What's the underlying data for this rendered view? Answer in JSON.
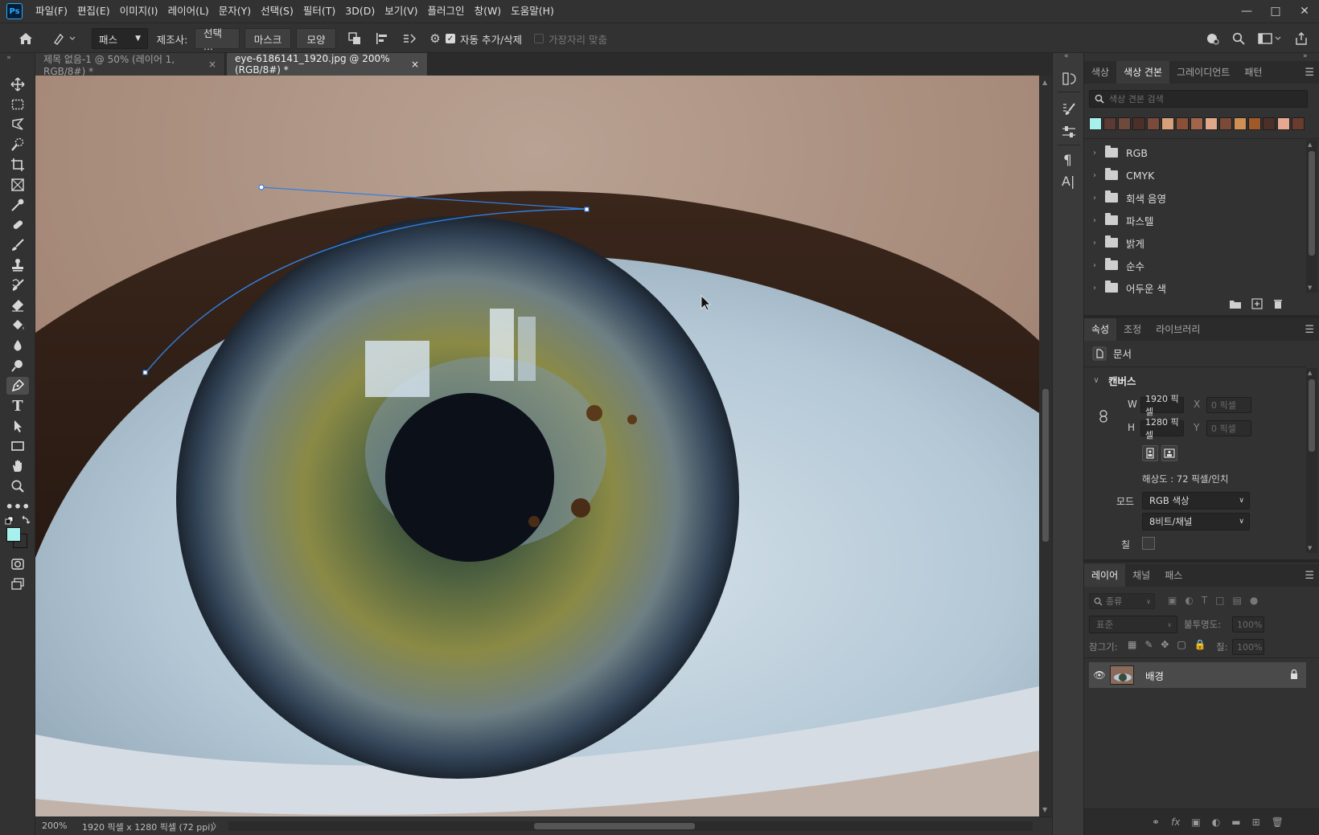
{
  "menu": [
    "파일(F)",
    "편집(E)",
    "이미지(I)",
    "레이어(L)",
    "문자(Y)",
    "선택(S)",
    "필터(T)",
    "3D(D)",
    "보기(V)",
    "플러그인",
    "창(W)",
    "도움말(H)"
  ],
  "app_logo": "Ps",
  "options": {
    "mode_select": "패스",
    "make_label": "제조사:",
    "make_selection": "선택 ...",
    "make_mask": "마스크",
    "make_shape": "모양",
    "auto_add_delete": "자동 추가/삭제",
    "auto_add_delete_checked": true,
    "align_edges": "가장자리 맞춤",
    "align_edges_checked": false
  },
  "tabs": [
    {
      "label": "제목 없음-1 @ 50% (레이어 1, RGB/8#) *",
      "active": false
    },
    {
      "label": "eye-6186141_1920.jpg @ 200% (RGB/8#) *",
      "active": true
    }
  ],
  "tab_close": "×",
  "status": {
    "zoom": "200%",
    "doc_size": "1920 픽셀 x 1280 픽셀 (72 ppi)",
    "arrow": "〉"
  },
  "swatches_panel": {
    "tabs": [
      "색상",
      "색상 견본",
      "그레이디언트",
      "패턴"
    ],
    "active_tab": 1,
    "search_placeholder": "색상 견본 검색",
    "colors": [
      "#a8f0ee",
      "#5a3a33",
      "#6e4a3d",
      "#4b2f28",
      "#7a4a3a",
      "#d6a07a",
      "#8a5038",
      "#a0654b",
      "#e0a888",
      "#7a4a36",
      "#d09055",
      "#a05a2a",
      "#4a3028",
      "#e8a890",
      "#6a3c30"
    ],
    "groups": [
      "RGB",
      "CMYK",
      "회색 음영",
      "파스텔",
      "밝게",
      "순수",
      "어두운 색"
    ]
  },
  "properties_panel": {
    "tabs": [
      "속성",
      "조정",
      "라이브러리"
    ],
    "active_tab": 0,
    "doc_label": "문서",
    "canvas_header": "캔버스",
    "w_label": "W",
    "w_value": "1920 픽셀",
    "h_label": "H",
    "h_value": "1280 픽셀",
    "x_label": "X",
    "x_placeholder": "0 픽셀",
    "y_label": "Y",
    "y_placeholder": "0 픽셀",
    "resolution": "해상도 : 72 픽셀/인치",
    "mode_label": "모드",
    "mode_value": "RGB 색상",
    "depth_value": "8비트/채널",
    "fill_label": "칠"
  },
  "layers_panel": {
    "tabs": [
      "레이어",
      "채널",
      "패스"
    ],
    "active_tab": 0,
    "filter_label": "종류",
    "blend_mode": "표준",
    "opacity_label": "불투명도:",
    "opacity_value": "100%",
    "lock_label": "잠그기:",
    "fill_label": "칠:",
    "fill_value": "100%",
    "layers": [
      {
        "name": "배경",
        "visible": true,
        "locked": true
      }
    ]
  },
  "colors": {
    "foreground": "#a8f0ee",
    "background": "#ffffff",
    "path_stroke": "#2f7fe0"
  }
}
